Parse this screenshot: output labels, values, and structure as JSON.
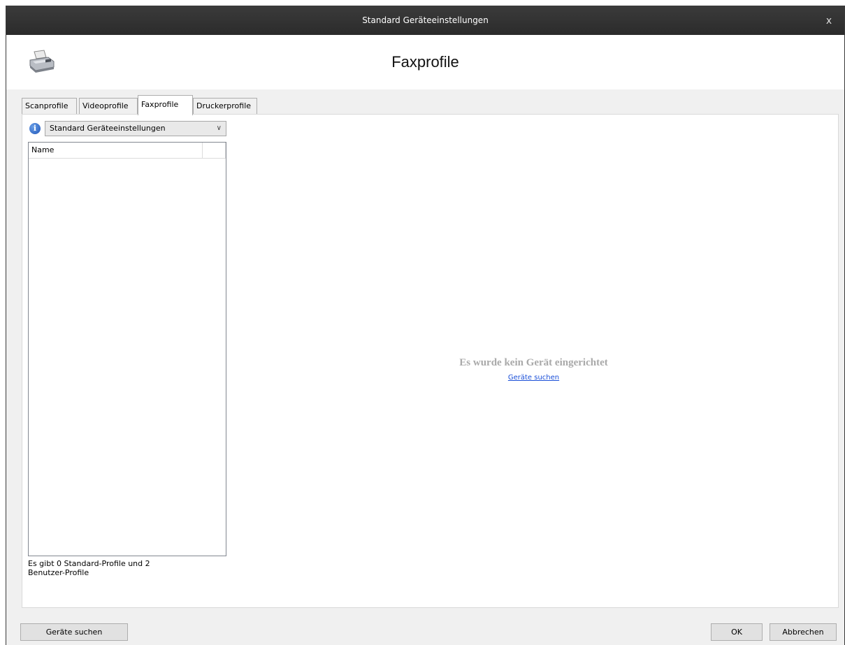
{
  "window": {
    "title": "Standard Geräteeinstellungen",
    "close_glyph": "x"
  },
  "header": {
    "title": "Faxprofile",
    "icon": "fax-machine-icon"
  },
  "tabs": [
    {
      "label": "Scanprofile",
      "active": false
    },
    {
      "label": "Videoprofile",
      "active": false
    },
    {
      "label": "Faxprofile",
      "active": true
    },
    {
      "label": "Druckerprofile",
      "active": false
    }
  ],
  "profile_selector": {
    "info_icon": "i",
    "selected": "Standard Geräteeinstellungen",
    "chevron": "∨"
  },
  "profile_list": {
    "columns": [
      "Name",
      ""
    ],
    "rows": []
  },
  "profile_count_text": "Es gibt 0 Standard-Profile und 2 Benutzer-Profile",
  "empty_state": {
    "title": "Es wurde kein Gerät eingerichtet",
    "link": "Geräte suchen"
  },
  "footer": {
    "search_button": "Geräte suchen",
    "ok_button": "OK",
    "cancel_button": "Abbrechen"
  }
}
